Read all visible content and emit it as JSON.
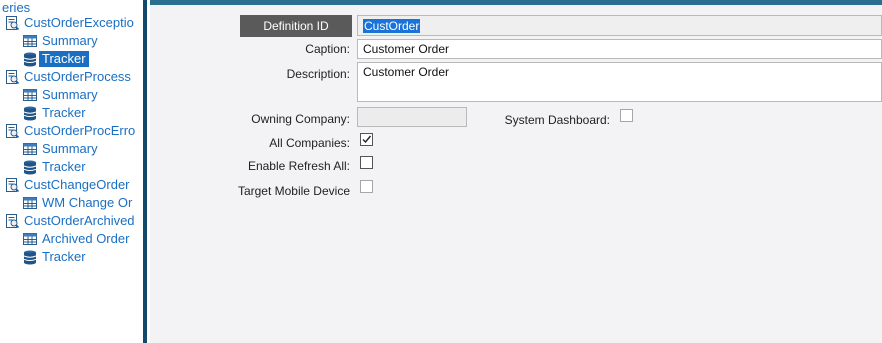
{
  "tree": {
    "header": "eries",
    "nodes": [
      {
        "label": "CustOrderExceptio",
        "icon": "report-icon",
        "level": 0
      },
      {
        "label": "Summary",
        "icon": "table-icon",
        "level": 1
      },
      {
        "label": "Tracker",
        "icon": "database-icon",
        "level": 1,
        "selected": true
      },
      {
        "label": "CustOrderProcess",
        "icon": "report-icon",
        "level": 0
      },
      {
        "label": "Summary",
        "icon": "table-icon",
        "level": 1
      },
      {
        "label": "Tracker",
        "icon": "database-icon",
        "level": 1
      },
      {
        "label": "CustOrderProcErro",
        "icon": "report-icon",
        "level": 0
      },
      {
        "label": "Summary",
        "icon": "table-icon",
        "level": 1
      },
      {
        "label": "Tracker",
        "icon": "database-icon",
        "level": 1
      },
      {
        "label": "CustChangeOrder",
        "icon": "report-icon",
        "level": 0
      },
      {
        "label": "WM Change Or",
        "icon": "table-icon",
        "level": 1
      },
      {
        "label": "CustOrderArchived",
        "icon": "report-icon",
        "level": 0
      },
      {
        "label": "Archived Order",
        "icon": "table-icon",
        "level": 1
      },
      {
        "label": "Tracker",
        "icon": "database-icon",
        "level": 1
      }
    ]
  },
  "form": {
    "definition_id_label": "Definition ID",
    "definition_id_value": "CustOrder",
    "caption_label": "Caption:",
    "caption_value": "Customer Order",
    "description_label": "Description:",
    "description_value": "Customer Order",
    "owning_company_label": "Owning Company:",
    "owning_company_value": "",
    "system_dashboard_label": "System Dashboard:",
    "system_dashboard_checked": false,
    "all_companies_label": "All Companies:",
    "all_companies_checked": true,
    "enable_refresh_label": "Enable Refresh All:",
    "enable_refresh_checked": false,
    "target_mobile_label": "Target Mobile Device",
    "target_mobile_checked": false
  },
  "colors": {
    "tree_text": "#1b6fc2",
    "selection": "#1b6fc2",
    "splitter": "#13496b",
    "top_strip": "#2b6f90",
    "panel_bg": "#f3f3f5"
  }
}
